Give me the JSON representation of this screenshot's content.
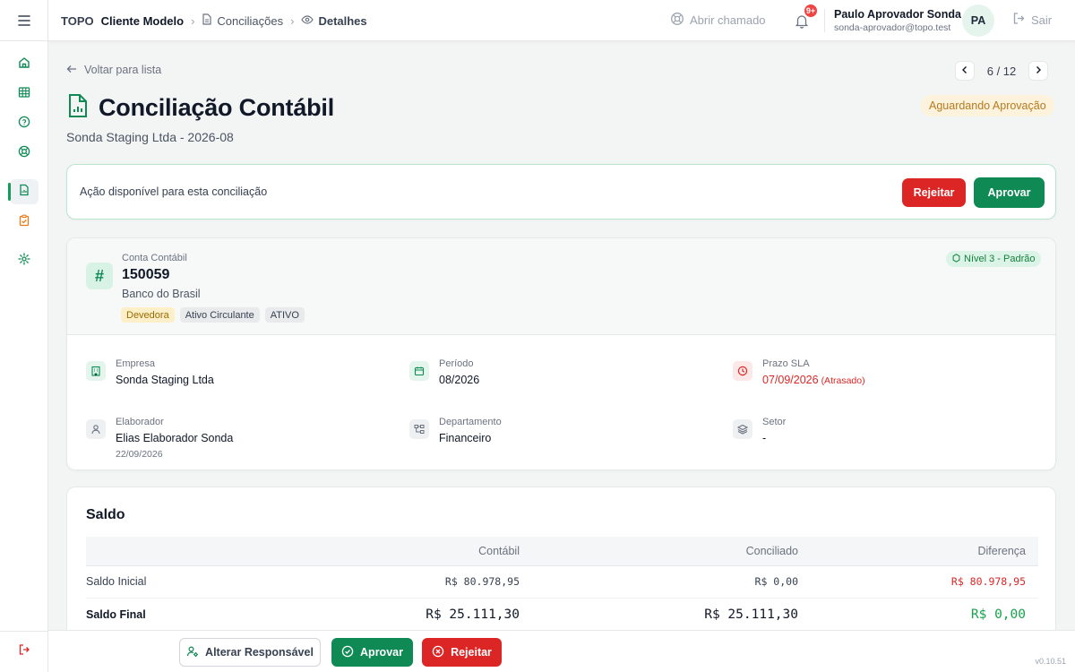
{
  "sidebar": {
    "menu_icon": "menu-icon",
    "items": [
      {
        "icon": "home-icon",
        "active": false
      },
      {
        "icon": "table-icon",
        "active": false
      },
      {
        "icon": "help-circle-icon",
        "active": false
      },
      {
        "icon": "lifebuoy-icon",
        "active": false
      },
      {
        "icon": "file-chart-icon",
        "active": true
      },
      {
        "icon": "clipboard-check-icon",
        "active": false
      },
      {
        "icon": "gear-icon",
        "active": false
      }
    ],
    "logout_icon": "logout-icon"
  },
  "header": {
    "brand": "TOPO",
    "client": "Cliente Modelo",
    "breadcrumb_section": "Conciliações",
    "breadcrumb_current": "Detalhes",
    "ticket_label": "Abrir chamado",
    "notification_badge": "9+",
    "user_name": "Paulo Aprovador Sonda",
    "user_email": "sonda-aprovador@topo.test",
    "avatar_initials": "PA",
    "exit_label": "Sair"
  },
  "page": {
    "back_label": "Voltar para lista",
    "pager": "6 / 12",
    "title": "Conciliação Contábil",
    "subtitle": "Sonda Staging Ltda - 2026-08",
    "status": "Aguardando Aprovação"
  },
  "action": {
    "text": "Ação disponível para esta conciliação",
    "reject_label": "Rejeitar",
    "approve_label": "Aprovar"
  },
  "account": {
    "label": "Conta Contábil",
    "number": "150059",
    "bank": "Banco do Brasil",
    "tags": [
      "Devedora",
      "Ativo Circulante",
      "ATIVO"
    ],
    "level": "Nível 3 - Padrão"
  },
  "details": {
    "empresa_label": "Empresa",
    "empresa_value": "Sonda Staging Ltda",
    "periodo_label": "Período",
    "periodo_value": "08/2026",
    "prazo_label": "Prazo SLA",
    "prazo_value": "07/09/2026",
    "prazo_note": "(Atrasado)",
    "elaborador_label": "Elaborador",
    "elaborador_value": "Elias Elaborador Sonda",
    "elaborador_date": "22/09/2026",
    "departamento_label": "Departamento",
    "departamento_value": "Financeiro",
    "setor_label": "Setor",
    "setor_value": "-"
  },
  "saldo": {
    "title": "Saldo",
    "columns": [
      "",
      "Contábil",
      "Conciliado",
      "Diferença"
    ],
    "rows": [
      {
        "label": "Saldo Inicial",
        "contabil": "R$ 80.978,95",
        "conciliado": "R$ 0,00",
        "diferenca": "R$ 80.978,95"
      },
      {
        "label": "Saldo Final",
        "contabil": "R$ 25.111,30",
        "conciliado": "R$ 25.111,30",
        "diferenca": "R$ 0,00"
      }
    ]
  },
  "bottom_bar": {
    "responsavel_label": "Alterar Responsável",
    "approve_label": "Aprovar",
    "reject_label": "Rejeitar",
    "version": "v0.10.51"
  },
  "colors": {
    "accent": "#0f8a55",
    "danger": "#dc2626",
    "warning_bg": "#fdf3dc"
  }
}
